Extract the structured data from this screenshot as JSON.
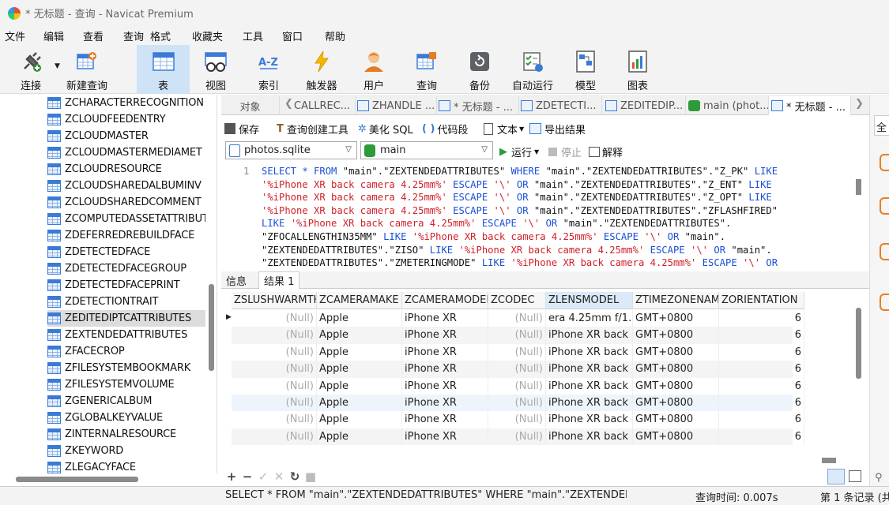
{
  "window": {
    "title": "* 无标题 - 查询 - Navicat Premium"
  },
  "menu": [
    "文件",
    "编辑",
    "查看",
    "查询",
    "格式",
    "收藏夹",
    "工具",
    "窗口",
    "帮助"
  ],
  "toolbar": [
    {
      "label": "连接",
      "icon": "plug-icon"
    },
    {
      "label": "新建查询",
      "icon": "new-query-icon"
    },
    {
      "label": "表",
      "icon": "table-icon",
      "active": true
    },
    {
      "label": "视图",
      "icon": "view-icon"
    },
    {
      "label": "索引",
      "icon": "index-icon"
    },
    {
      "label": "触发器",
      "icon": "trigger-icon"
    },
    {
      "label": "用户",
      "icon": "user-icon"
    },
    {
      "label": "查询",
      "icon": "query-icon"
    },
    {
      "label": "备份",
      "icon": "backup-icon"
    },
    {
      "label": "自动运行",
      "icon": "autorun-icon"
    },
    {
      "label": "模型",
      "icon": "model-icon"
    },
    {
      "label": "图表",
      "icon": "chart-icon"
    }
  ],
  "tree": {
    "items": [
      "ZCHARACTERRECOGNITION",
      "ZCLOUDFEEDENTRY",
      "ZCLOUDMASTER",
      "ZCLOUDMASTERMEDIAMET",
      "ZCLOUDRESOURCE",
      "ZCLOUDSHAREDALBUMINV",
      "ZCLOUDSHAREDCOMMENT",
      "ZCOMPUTEDASSETATTRIBUT",
      "ZDEFERREDREBUILDFACE",
      "ZDETECTEDFACE",
      "ZDETECTEDFACEGROUP",
      "ZDETECTEDFACEPRINT",
      "ZDETECTIONTRAIT",
      "ZEDITEDIPTCATTRIBUTES",
      "ZEXTENDEDATTRIBUTES",
      "ZFACECROP",
      "ZFILESYSTEMBOOKMARK",
      "ZFILESYSTEMVOLUME",
      "ZGENERICALBUM",
      "ZGLOBALKEYVALUE",
      "ZINTERNALRESOURCE",
      "ZKEYWORD",
      "ZLEGACYFACE"
    ],
    "selected_index": 13
  },
  "tabs": [
    {
      "label": "对象"
    },
    {
      "label": "CALLREC..."
    },
    {
      "label": "ZHANDLE ..."
    },
    {
      "label": "* 无标题 - ..."
    },
    {
      "label": "ZDETECTI..."
    },
    {
      "label": "ZEDITEDIP..."
    },
    {
      "label": "main (phot..."
    },
    {
      "label": "* 无标题 - ..."
    }
  ],
  "editor_toolbar": {
    "save": "保存",
    "query_builder": "查询创建工具",
    "beautify": "美化 SQL",
    "snippet": "代码段",
    "text": "文本",
    "export": "导出结果"
  },
  "connection": {
    "database": "photos.sqlite",
    "schema": "main",
    "run": "运行",
    "stop": "停止",
    "explain": "解释"
  },
  "sql": {
    "line_number": "1",
    "lines": [
      [
        [
          "kw",
          "SELECT * FROM "
        ],
        [
          "id",
          "\"main\".\"ZEXTENDEDATTRIBUTES\" "
        ],
        [
          "kw",
          "WHERE "
        ],
        [
          "id",
          "\"main\".\"ZEXTENDEDATTRIBUTES\".\"Z_PK\" "
        ],
        [
          "kw",
          "LIKE"
        ]
      ],
      [
        [
          "str",
          "'%iPhone XR back camera 4.25mm%' "
        ],
        [
          "kw",
          "ESCAPE "
        ],
        [
          "str",
          "'\\' "
        ],
        [
          "kw",
          "OR "
        ],
        [
          "id",
          "\"main\".\"ZEXTENDEDATTRIBUTES\".\"Z_ENT\" "
        ],
        [
          "kw",
          "LIKE"
        ]
      ],
      [
        [
          "str",
          "'%iPhone XR back camera 4.25mm%' "
        ],
        [
          "kw",
          "ESCAPE "
        ],
        [
          "str",
          "'\\' "
        ],
        [
          "kw",
          "OR "
        ],
        [
          "id",
          "\"main\".\"ZEXTENDEDATTRIBUTES\".\"Z_OPT\" "
        ],
        [
          "kw",
          "LIKE"
        ]
      ],
      [
        [
          "str",
          "'%iPhone XR back camera 4.25mm%' "
        ],
        [
          "kw",
          "ESCAPE "
        ],
        [
          "str",
          "'\\' "
        ],
        [
          "kw",
          "OR "
        ],
        [
          "id",
          "\"main\".\"ZEXTENDEDATTRIBUTES\".\"ZFLASHFIRED\""
        ]
      ],
      [
        [
          "kw",
          "LIKE "
        ],
        [
          "str",
          "'%iPhone XR back camera 4.25mm%' "
        ],
        [
          "kw",
          "ESCAPE "
        ],
        [
          "str",
          "'\\' "
        ],
        [
          "kw",
          "OR "
        ],
        [
          "id",
          "\"main\".\"ZEXTENDEDATTRIBUTES\"."
        ]
      ],
      [
        [
          "id",
          "\"ZFOCALLENGTHIN35MM\" "
        ],
        [
          "kw",
          "LIKE "
        ],
        [
          "str",
          "'%iPhone XR back camera 4.25mm%' "
        ],
        [
          "kw",
          "ESCAPE "
        ],
        [
          "str",
          "'\\' "
        ],
        [
          "kw",
          "OR "
        ],
        [
          "id",
          "\"main\"."
        ]
      ],
      [
        [
          "id",
          "\"ZEXTENDEDATTRIBUTES\".\"ZISO\" "
        ],
        [
          "kw",
          "LIKE "
        ],
        [
          "str",
          "'%iPhone XR back camera 4.25mm%' "
        ],
        [
          "kw",
          "ESCAPE "
        ],
        [
          "str",
          "'\\' "
        ],
        [
          "kw",
          "OR "
        ],
        [
          "id",
          "\"main\"."
        ]
      ],
      [
        [
          "id",
          "\"ZEXTENDEDATTRIBUTES\".\"ZMETERINGMODE\" "
        ],
        [
          "kw",
          "LIKE "
        ],
        [
          "str",
          "'%iPhone XR back camera 4.25mm%' "
        ],
        [
          "kw",
          "ESCAPE "
        ],
        [
          "str",
          "'\\' "
        ],
        [
          "kw",
          "OR"
        ]
      ]
    ]
  },
  "result_tabs": [
    "信息",
    "结果 1"
  ],
  "grid": {
    "columns": [
      "ZSLUSHWARMTH",
      "ZCAMERAMAKE",
      "ZCAMERAMODEL",
      "ZCODEC",
      "ZLENSMODEL",
      "ZTIMEZONENAME",
      "ZORIENTATION"
    ],
    "rows": [
      [
        "(Null)",
        "Apple",
        "iPhone XR",
        "(Null)",
        "era 4.25mm f/1.8",
        "GMT+0800",
        "6"
      ],
      [
        "(Null)",
        "Apple",
        "iPhone XR",
        "(Null)",
        "iPhone XR back c",
        "GMT+0800",
        "6"
      ],
      [
        "(Null)",
        "Apple",
        "iPhone XR",
        "(Null)",
        "iPhone XR back c",
        "GMT+0800",
        "6"
      ],
      [
        "(Null)",
        "Apple",
        "iPhone XR",
        "(Null)",
        "iPhone XR back c",
        "GMT+0800",
        "6"
      ],
      [
        "(Null)",
        "Apple",
        "iPhone XR",
        "(Null)",
        "iPhone XR back c",
        "GMT+0800",
        "6"
      ],
      [
        "(Null)",
        "Apple",
        "iPhone XR",
        "(Null)",
        "iPhone XR back c",
        "GMT+0800",
        "6"
      ],
      [
        "(Null)",
        "Apple",
        "iPhone XR",
        "(Null)",
        "iPhone XR back c",
        "GMT+0800",
        "6"
      ],
      [
        "(Null)",
        "Apple",
        "iPhone XR",
        "(Null)",
        "iPhone XR back c",
        "GMT+0800",
        "6"
      ]
    ]
  },
  "status": {
    "sql": "SELECT * FROM \"main\".\"ZEXTENDEDATTRIBUTES\" WHERE \"main\".\"ZEXTENDEDAT",
    "time": "查询时间: 0.007s",
    "records": "第 1 条记录 (共"
  },
  "right_panel": {
    "label": "全"
  }
}
